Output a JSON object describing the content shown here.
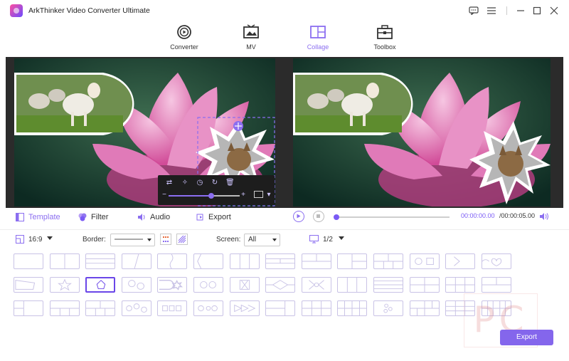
{
  "app": {
    "title": "ArkThinker Video Converter Ultimate",
    "accent_color": "#8b6ef0"
  },
  "window_controls": {
    "items": [
      {
        "icon": "feedback-icon"
      },
      {
        "icon": "menu-icon"
      },
      {
        "icon": "minimize-icon"
      },
      {
        "icon": "maximize-icon"
      },
      {
        "icon": "close-icon"
      }
    ]
  },
  "nav": {
    "tabs": [
      {
        "label": "Converter",
        "icon": "converter-icon",
        "active": false
      },
      {
        "label": "MV",
        "icon": "mv-icon",
        "active": false
      },
      {
        "label": "Collage",
        "icon": "collage-icon",
        "active": true
      },
      {
        "label": "Toolbox",
        "icon": "toolbox-icon",
        "active": false
      }
    ]
  },
  "subtabs": {
    "items": [
      {
        "label": "Template",
        "icon": "template-icon",
        "active": true
      },
      {
        "label": "Filter",
        "icon": "filter-icon",
        "active": false
      },
      {
        "label": "Audio",
        "icon": "audio-icon",
        "active": false
      },
      {
        "label": "Export",
        "icon": "export-icon",
        "active": false
      }
    ]
  },
  "player": {
    "current_time": "00:00:00.00",
    "total_time": "/00:00:05.00",
    "progress": 0.0
  },
  "edit_toolbar": {
    "zoom_level": 0.6
  },
  "settings": {
    "aspect_ratio": "16:9",
    "border_label": "Border:",
    "screen_label": "Screen:",
    "screen_value": "All",
    "page_value": "1/2"
  },
  "templates": {
    "selected_index": 16
  },
  "watermark_text": "PC",
  "export_button": "Export"
}
